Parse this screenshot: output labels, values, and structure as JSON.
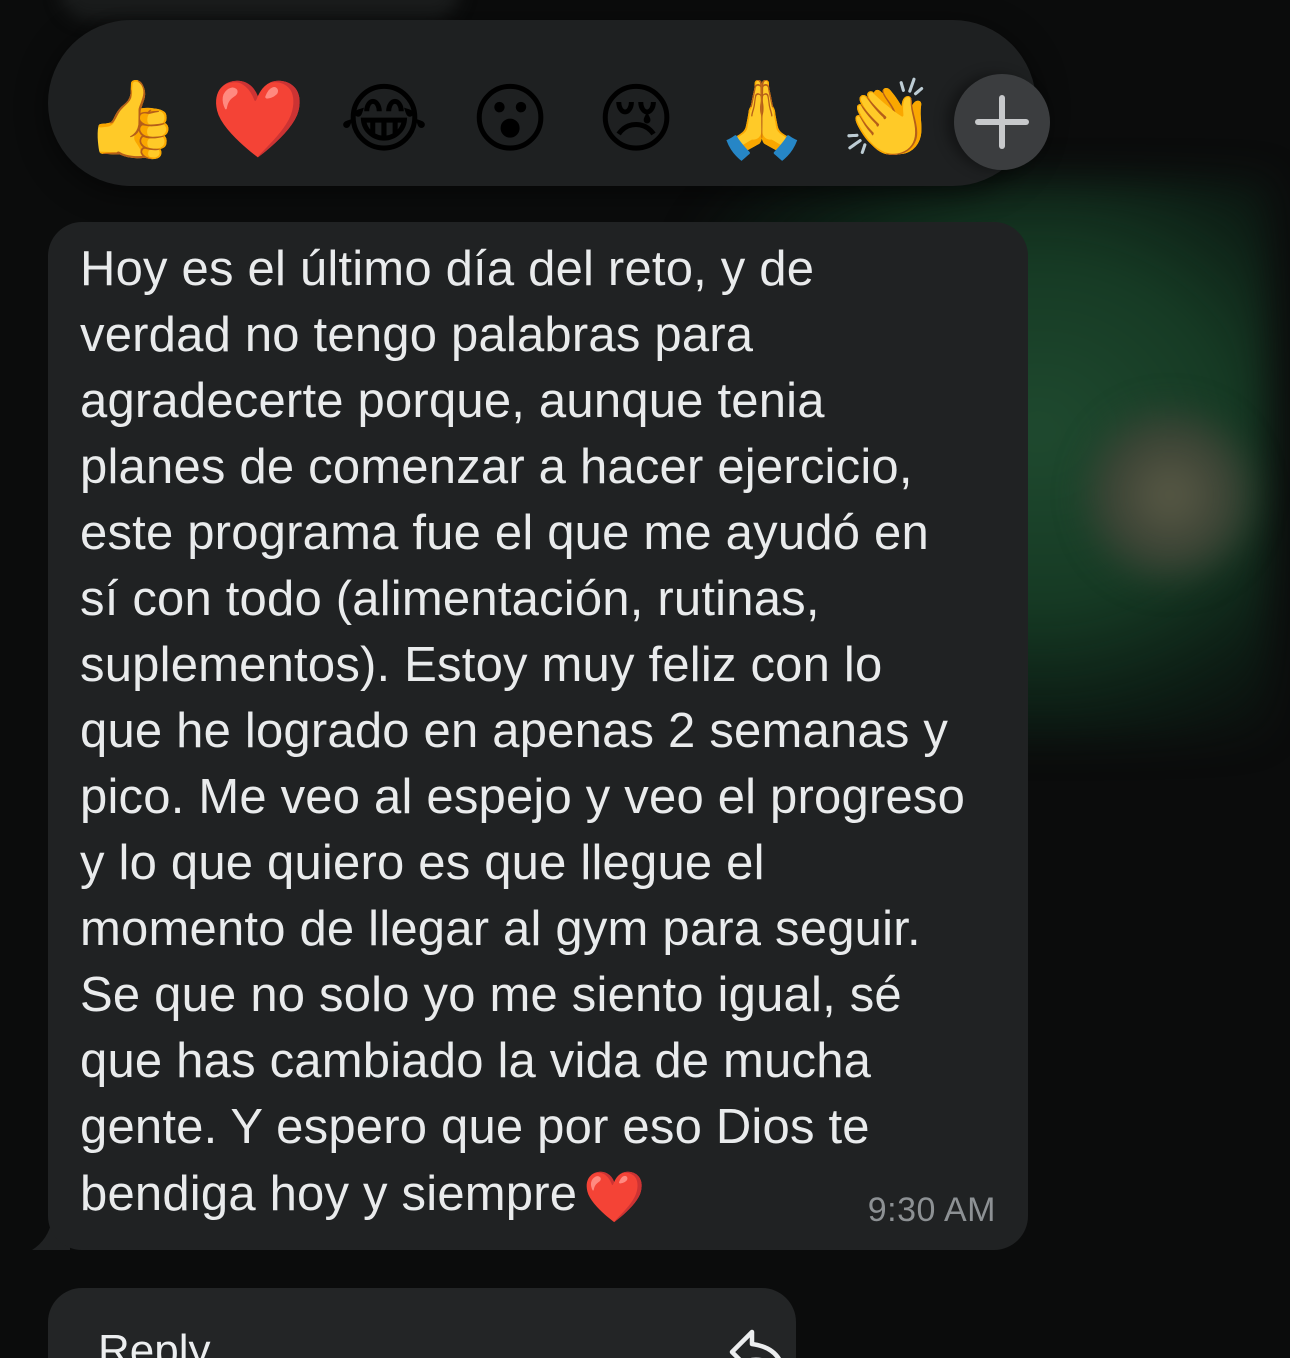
{
  "reactions": [
    {
      "icon": "thumbs-up-icon",
      "glyph": "👍"
    },
    {
      "icon": "red-heart-icon",
      "glyph": "❤️"
    },
    {
      "icon": "tears-of-joy-icon",
      "glyph": "😂"
    },
    {
      "icon": "surprised-face-icon",
      "glyph": "😮"
    },
    {
      "icon": "crying-face-icon",
      "glyph": "😢"
    },
    {
      "icon": "folded-hands-icon",
      "glyph": "🙏"
    },
    {
      "icon": "clapping-hands-icon",
      "glyph": "👏"
    }
  ],
  "more_reactions_icon": "plus-icon",
  "message": {
    "text": "Hoy es el último día del reto, y de\nverdad no tengo palabras para\nagradecerte porque, aunque tenia\nplanes de comenzar a hacer ejercicio,\neste programa fue el que me ayudó en\nsí con todo (alimentación, rutinas,\nsuplementos). Estoy muy feliz con lo\nque he logrado en apenas 2 semanas y\npico. Me veo al espejo y veo el progreso\ny lo que quiero es que llegue el\nmomento de llegar al gym para seguir.\nSe que no solo yo me siento igual, sé\nque has cambiado la vida de mucha\ngente. Y espero que por eso Dios te\nbendiga hoy y siempre",
    "trailing_emoji": "❤️",
    "time": "9:30 AM"
  },
  "menu": {
    "reply_label": "Reply",
    "reply_icon": "reply-arrow-icon"
  },
  "colors": {
    "background": "#0b0c0c",
    "bubble": "#202223",
    "reaction_bar": "#1e2021",
    "text": "#e9ebec",
    "timestamp": "#8d9194"
  }
}
